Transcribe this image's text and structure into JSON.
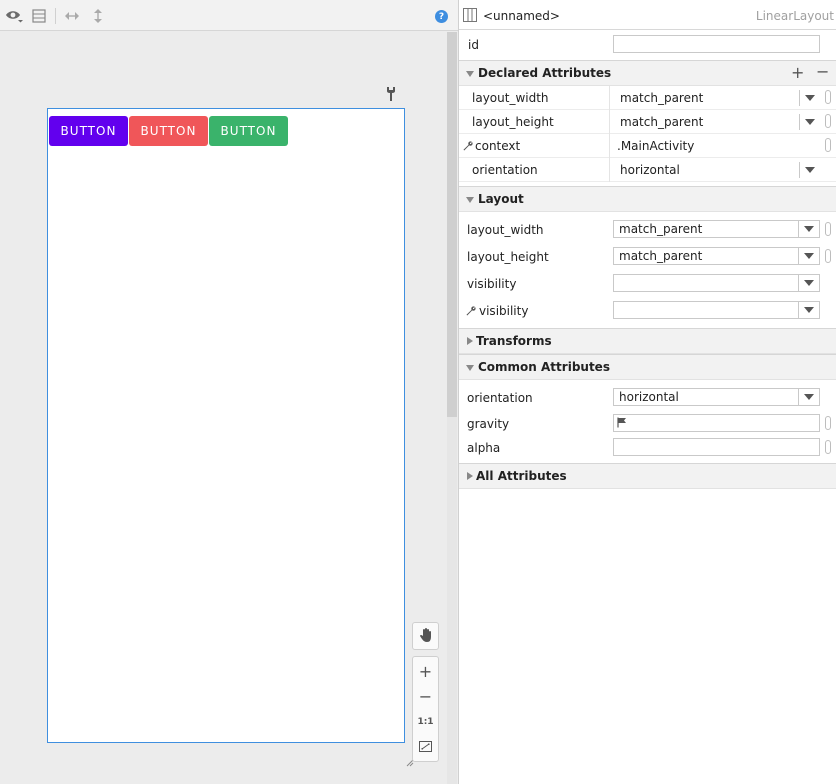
{
  "preview": {
    "buttons": [
      {
        "label": "BUTTON",
        "color": "#6200ee"
      },
      {
        "label": "BUTTON",
        "color": "#f05659"
      },
      {
        "label": "BUTTON",
        "color": "#3ab36b"
      }
    ],
    "zoom": {
      "plus": "+",
      "minus": "−",
      "one_to_one": "1:1"
    },
    "help": "?"
  },
  "attributes": {
    "header": {
      "name": "<unnamed>",
      "type": "LinearLayout"
    },
    "id_label": "id",
    "id_value": "",
    "declared": {
      "title": "Declared Attributes",
      "add": "+",
      "remove": "−",
      "rows": [
        {
          "label": "layout_width",
          "value": "match_parent"
        },
        {
          "label": "layout_height",
          "value": "match_parent"
        },
        {
          "label": "context",
          "value": ".MainActivity"
        },
        {
          "label": "orientation",
          "value": "horizontal"
        }
      ]
    },
    "layout": {
      "title": "Layout",
      "rows": [
        {
          "label": "layout_width",
          "value": "match_parent"
        },
        {
          "label": "layout_height",
          "value": "match_parent"
        },
        {
          "label": "visibility",
          "value": ""
        },
        {
          "label": "visibility",
          "value": ""
        }
      ]
    },
    "transforms": {
      "title": "Transforms"
    },
    "common": {
      "title": "Common Attributes",
      "rows": [
        {
          "label": "orientation",
          "value": "horizontal"
        },
        {
          "label": "gravity",
          "value": ""
        },
        {
          "label": "alpha",
          "value": ""
        }
      ]
    },
    "all": {
      "title": "All Attributes"
    }
  }
}
